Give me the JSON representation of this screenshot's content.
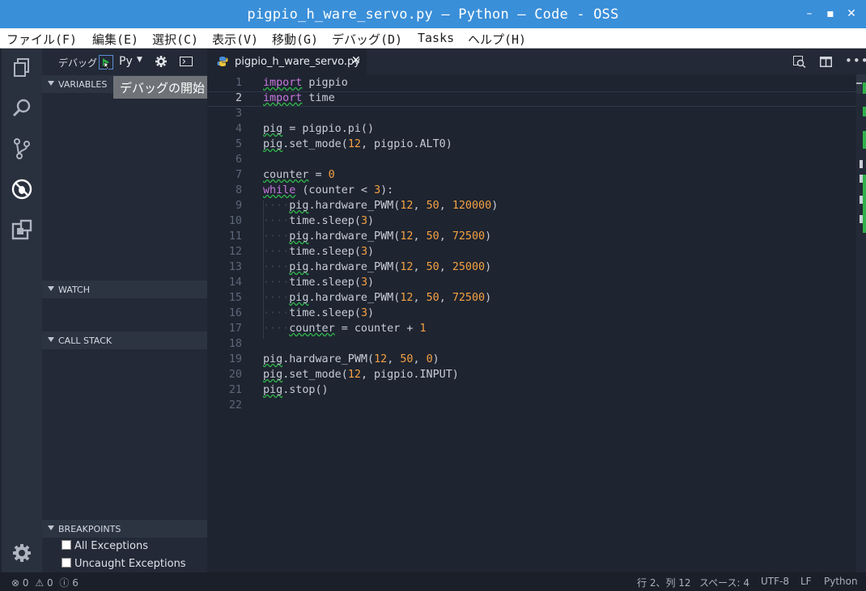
{
  "window": {
    "title": "pigpio_h_ware_servo.py — Python — Code - OSS"
  },
  "menu": [
    "ファイル(F)",
    "編集(E)",
    "選択(C)",
    "表示(V)",
    "移動(G)",
    "デバッグ(D)",
    "Tasks",
    "ヘルプ(H)"
  ],
  "debug": {
    "label": "デバッグ",
    "config": "Py",
    "tooltip": "デバッグの開始"
  },
  "sections": {
    "variables": "VARIABLES",
    "watch": "WATCH",
    "callstack": "CALL STACK",
    "breakpoints": "BREAKPOINTS"
  },
  "breakpoints": [
    "All Exceptions",
    "Uncaught Exceptions"
  ],
  "tab": {
    "name": "pigpio_h_ware_servo.py"
  },
  "code": {
    "lines": [
      "import pigpio",
      "import time",
      "",
      "pig = pigpio.pi()",
      "pig.set_mode(12, pigpio.ALT0)",
      "",
      "counter = 0",
      "while (counter < 3):",
      "    pig.hardware_PWM(12, 50, 120000)",
      "    time.sleep(3)",
      "    pig.hardware_PWM(12, 50, 72500)",
      "    time.sleep(3)",
      "    pig.hardware_PWM(12, 50, 25000)",
      "    time.sleep(3)",
      "    pig.hardware_PWM(12, 50, 72500)",
      "    time.sleep(3)",
      "    counter = counter + 1",
      "",
      "pig.hardware_PWM(12, 50, 0)",
      "pig.set_mode(12, pigpio.INPUT)",
      "pig.stop()",
      ""
    ],
    "current_line": 2
  },
  "status": {
    "errors": "0",
    "warnings": "0",
    "infos": "6",
    "position": "行 2、列 12",
    "spaces": "スペース: 4",
    "encoding": "UTF-8",
    "eol": "LF",
    "language": "Python"
  }
}
